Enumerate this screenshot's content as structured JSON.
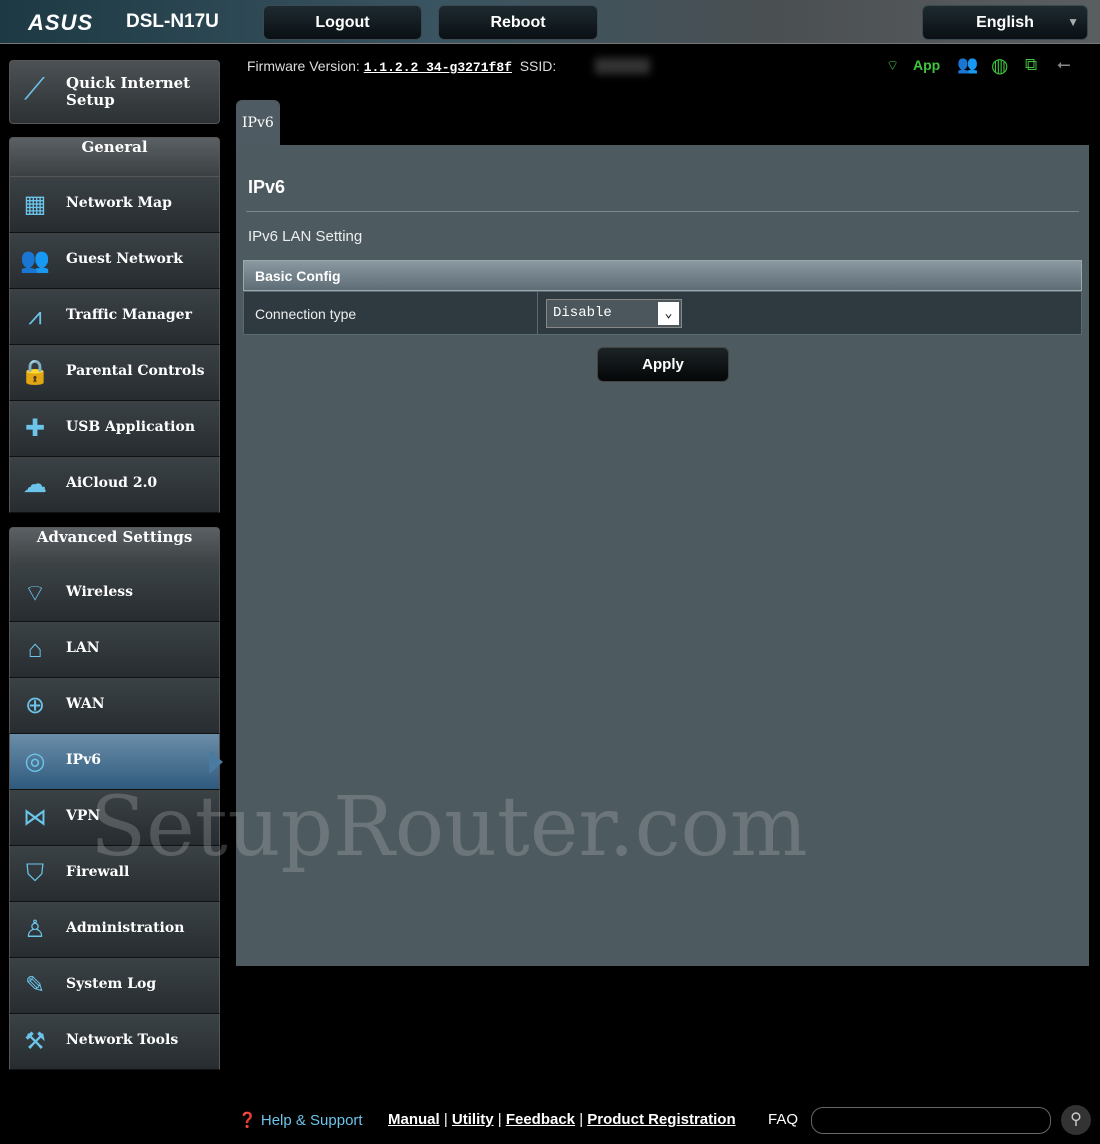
{
  "header": {
    "logo": "ASUS",
    "model": "DSL-N17U",
    "logout": "Logout",
    "reboot": "Reboot",
    "language": "English"
  },
  "info": {
    "firmware_label": "Firmware Version:",
    "firmware_version": "1.1.2.2_34-g3271f8f",
    "ssid_label": "SSID:",
    "app_label": "App"
  },
  "sidebar": {
    "quick_setup": "Quick Internet Setup",
    "general_title": "General",
    "general": [
      {
        "label": "Network Map",
        "icon": "network-map-icon"
      },
      {
        "label": "Guest Network",
        "icon": "guest-network-icon"
      },
      {
        "label": "Traffic Manager",
        "icon": "traffic-manager-icon"
      },
      {
        "label": "Parental Controls",
        "icon": "lock-icon"
      },
      {
        "label": "USB Application",
        "icon": "puzzle-icon"
      },
      {
        "label": "AiCloud 2.0",
        "icon": "cloud-icon"
      }
    ],
    "advanced_title": "Advanced Settings",
    "advanced": [
      {
        "label": "Wireless",
        "icon": "wifi-icon"
      },
      {
        "label": "LAN",
        "icon": "home-icon"
      },
      {
        "label": "WAN",
        "icon": "globe-icon"
      },
      {
        "label": "IPv6",
        "icon": "ipv6-icon"
      },
      {
        "label": "VPN",
        "icon": "vpn-icon"
      },
      {
        "label": "Firewall",
        "icon": "shield-icon"
      },
      {
        "label": "Administration",
        "icon": "user-icon"
      },
      {
        "label": "System Log",
        "icon": "log-icon"
      },
      {
        "label": "Network Tools",
        "icon": "tools-icon"
      }
    ],
    "active": "IPv6"
  },
  "main": {
    "tab": "IPv6",
    "title": "IPv6",
    "subtitle": "IPv6 LAN Setting",
    "section": "Basic Config",
    "connection_type_label": "Connection type",
    "connection_type_value": "Disable",
    "apply": "Apply"
  },
  "watermark": "SetupRouter.com",
  "footer": {
    "help": "Help & Support",
    "links": [
      "Manual",
      "Utility",
      "Feedback",
      "Product Registration"
    ],
    "faq": "FAQ"
  },
  "colors": {
    "status_green": "#3ec43e",
    "accent_blue": "#6cc4ea",
    "panel": "#4d5a60"
  }
}
